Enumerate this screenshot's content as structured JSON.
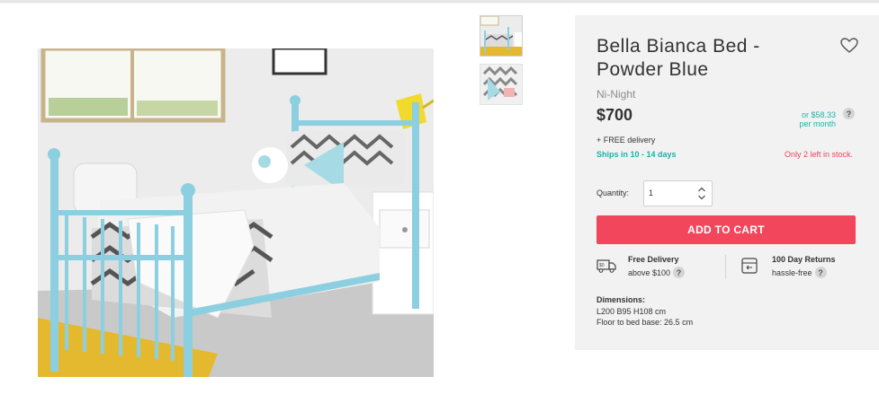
{
  "product": {
    "title": "Bella Bianca Bed - Powder Blue",
    "brand": "Ni-Night",
    "price": "$700",
    "monthly_line1": "or $58.33",
    "monthly_line2": "per month",
    "help_glyph": "?",
    "free_delivery_note": "+ FREE delivery",
    "ships": "Ships in 10 - 14 days",
    "stock": "Only 2 left in stock."
  },
  "quantity": {
    "label": "Quantity:",
    "value": "1"
  },
  "cart": {
    "button_label": "ADD TO CART"
  },
  "perks": [
    {
      "title": "Free Delivery",
      "subtitle": "above $100",
      "icon": "delivery-truck-icon"
    },
    {
      "title": "100 Day Returns",
      "subtitle": "hassle-free",
      "icon": "returns-box-icon"
    }
  ],
  "dimensions": {
    "label": "Dimensions:",
    "size": "L200 B95 H108 cm",
    "floor": "Floor to bed base: 26.5 cm"
  },
  "gallery": {
    "thumbnail_count": 2,
    "selected_index": 0
  },
  "colors": {
    "accent_teal": "#1cb3a6",
    "cart_red": "#f2465c",
    "stock_red": "#e8475a",
    "panel_bg": "#f2f2f2",
    "bed_blue": "#8ccfe0"
  }
}
